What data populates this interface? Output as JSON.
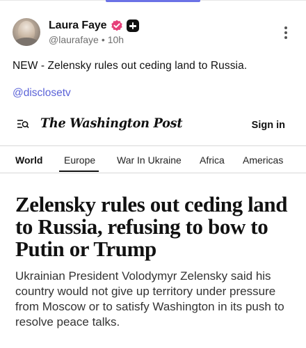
{
  "post": {
    "author": {
      "display_name": "Laura Faye",
      "handle": "@laurafaye",
      "separator": "•",
      "time_ago": "10h"
    },
    "text": "NEW - Zelensky rules out ceding land to Russia.",
    "mention": "@disclosetv",
    "icons": {
      "verified": "verified-badge-icon",
      "subscription": "plus-badge-icon",
      "more": "more-vertical-icon"
    }
  },
  "article_card": {
    "publication": "The Washington Post",
    "sign_in_label": "Sign in",
    "nav": {
      "items": [
        "World",
        "Europe",
        "War In Ukraine",
        "Africa",
        "Americas"
      ],
      "active_index": 0,
      "underlined_index": 1
    },
    "headline": "Zelensky rules out ceding land to Russia, refusing to bow to Putin or Trump",
    "subhead": "Ukrainian President Volodymyr Zelensky said his country would not give up territory under pressure from Moscow or to satisfy Washington in its push to resolve peace talks."
  },
  "colors": {
    "accent": "#6b72e6",
    "mention": "#5b63d8",
    "verified": "#e6407a"
  }
}
